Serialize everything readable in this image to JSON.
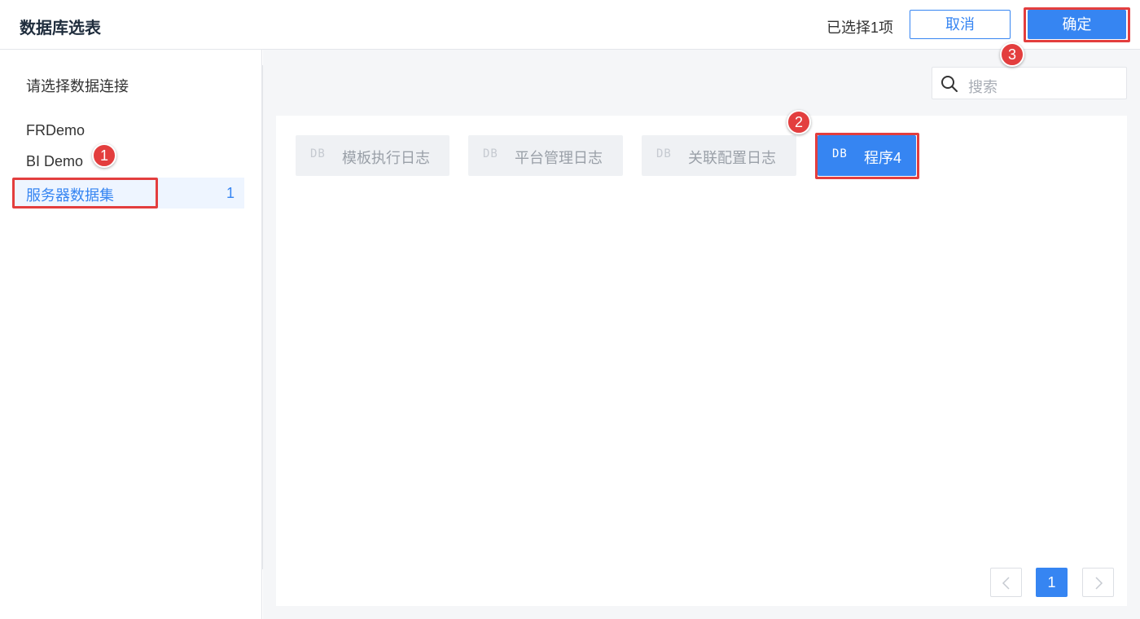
{
  "header": {
    "title": "数据库选表",
    "selected_count": "已选择1项",
    "cancel_label": "取消",
    "confirm_label": "确定"
  },
  "sidebar": {
    "prompt": "请选择数据连接",
    "connections": [
      {
        "label": "FRDemo"
      },
      {
        "label": "BI Demo"
      },
      {
        "label": "服务器数据集",
        "count": "1",
        "active": true
      }
    ]
  },
  "search": {
    "placeholder": "搜索",
    "icon": "search-icon"
  },
  "tables": [
    {
      "prefix": "DB",
      "name": "模板执行日志",
      "selected": false
    },
    {
      "prefix": "DB",
      "name": "平台管理日志",
      "selected": false
    },
    {
      "prefix": "DB",
      "name": "关联配置日志",
      "selected": false
    },
    {
      "prefix": "DB",
      "name": "程序4",
      "selected": true
    }
  ],
  "pagination": {
    "current_page": "1",
    "prev_icon": "chevron-left-icon",
    "next_icon": "chevron-right-icon"
  },
  "annotations": [
    "1",
    "2",
    "3"
  ],
  "colors": {
    "accent": "#3685f2",
    "highlight": "#e33e3e",
    "selected_bg": "#eef5ff",
    "panel_bg": "#f5f6f8"
  }
}
